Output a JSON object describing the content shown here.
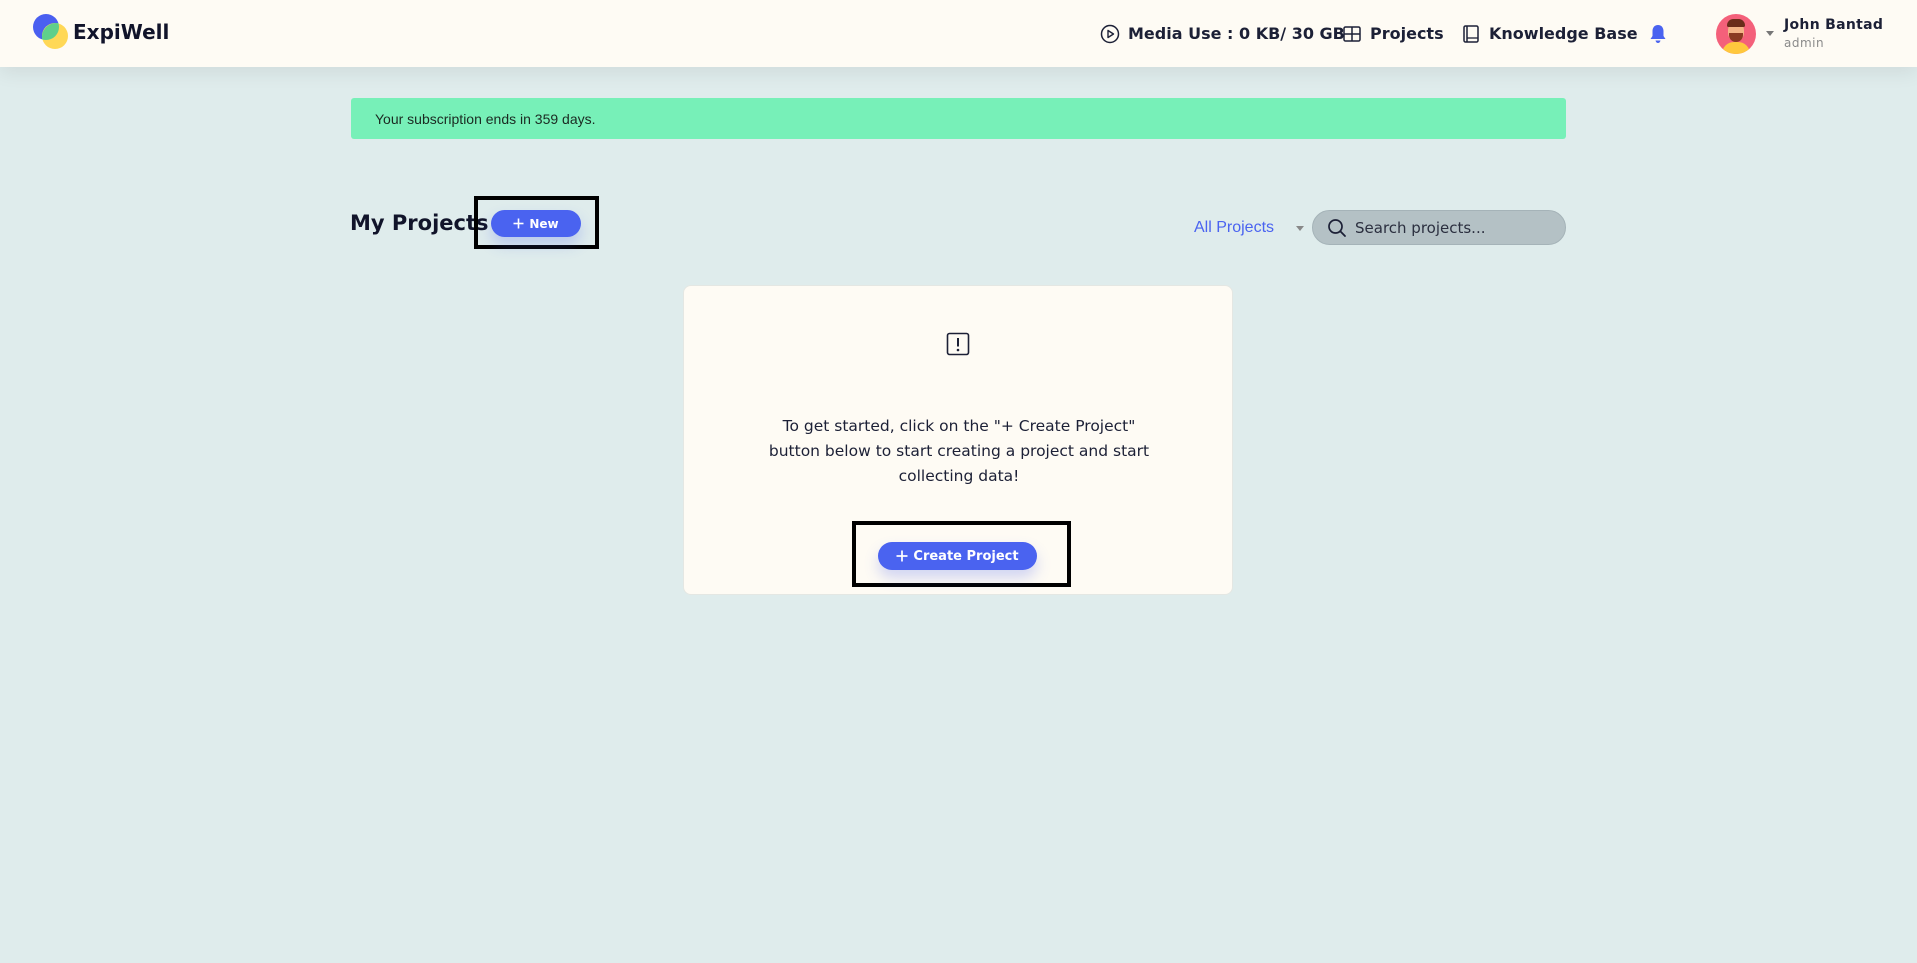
{
  "header": {
    "logo_text": "ExpiWell",
    "media_use": "Media Use : 0 KB/ 30 GB",
    "projects": "Projects",
    "knowledge_base": "Knowledge Base",
    "user": {
      "name": "John Bantad",
      "role": "admin"
    }
  },
  "banner": {
    "text": "Your subscription ends in 359 days."
  },
  "toolbar": {
    "title": "My Projects",
    "new_button": "New",
    "filter": "All Projects",
    "search_placeholder": "Search projects..."
  },
  "empty_state": {
    "message": "To get started, click on the \"+ Create Project\" button below to start creating a project and start collecting data!",
    "create_button": "Create Project"
  },
  "colors": {
    "accent": "#4a63f0",
    "banner": "#77f0b8",
    "background": "#dfecec",
    "header": "#fefbf4"
  }
}
